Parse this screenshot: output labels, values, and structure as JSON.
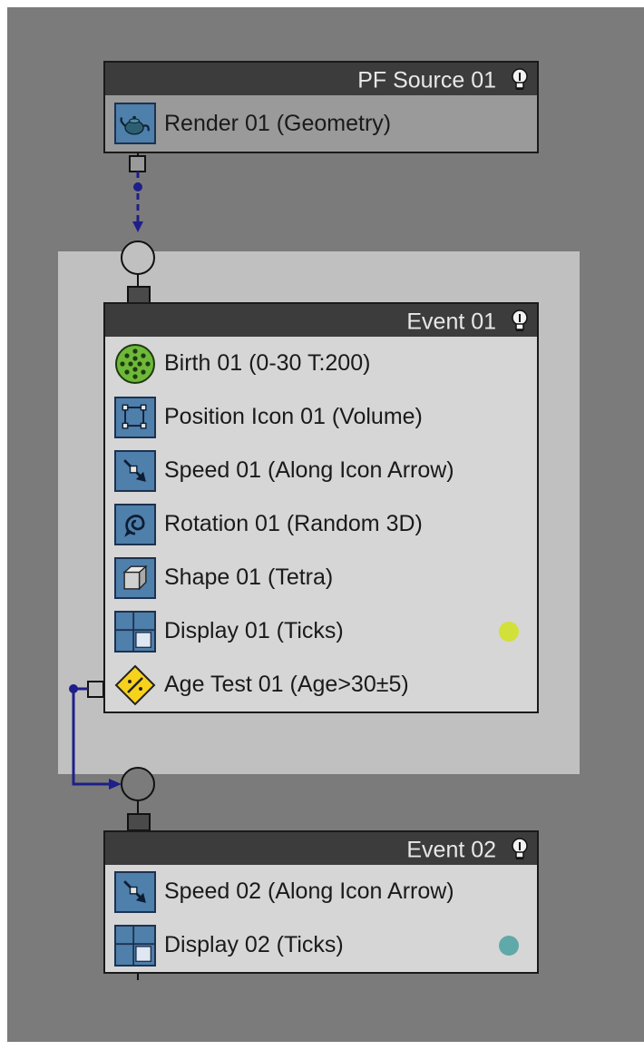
{
  "colors": {
    "canvas_bg": "#7b7b7b",
    "selection_region": "#c0c0c0",
    "header_bg": "#3c3c3c",
    "wire": "#1f1f8a",
    "display_01_dot": "#d2e03a",
    "display_02_dot": "#5fa9a9"
  },
  "nodes": {
    "source": {
      "title": "PF Source 01",
      "operators": [
        {
          "label": "Render 01 (Geometry)",
          "icon": "teapot-icon"
        }
      ]
    },
    "event01": {
      "title": "Event 01",
      "operators": [
        {
          "label": "Birth 01 (0-30 T:200)",
          "icon": "birth-icon"
        },
        {
          "label": "Position Icon 01 (Volume)",
          "icon": "position-icon"
        },
        {
          "label": "Speed 01 (Along Icon Arrow)",
          "icon": "speed-arrow-icon"
        },
        {
          "label": "Rotation 01 (Random 3D)",
          "icon": "rotation-icon"
        },
        {
          "label": "Shape 01 (Tetra)",
          "icon": "shape-cube-icon"
        },
        {
          "label": "Display 01 (Ticks)",
          "icon": "display-icon"
        },
        {
          "label": "Age Test 01 (Age>30±5)",
          "icon": "age-test-diamond-icon"
        }
      ]
    },
    "event02": {
      "title": "Event 02",
      "operators": [
        {
          "label": "Speed 02 (Along Icon Arrow)",
          "icon": "speed-arrow-icon"
        },
        {
          "label": "Display 02 (Ticks)",
          "icon": "display-icon"
        }
      ]
    }
  }
}
